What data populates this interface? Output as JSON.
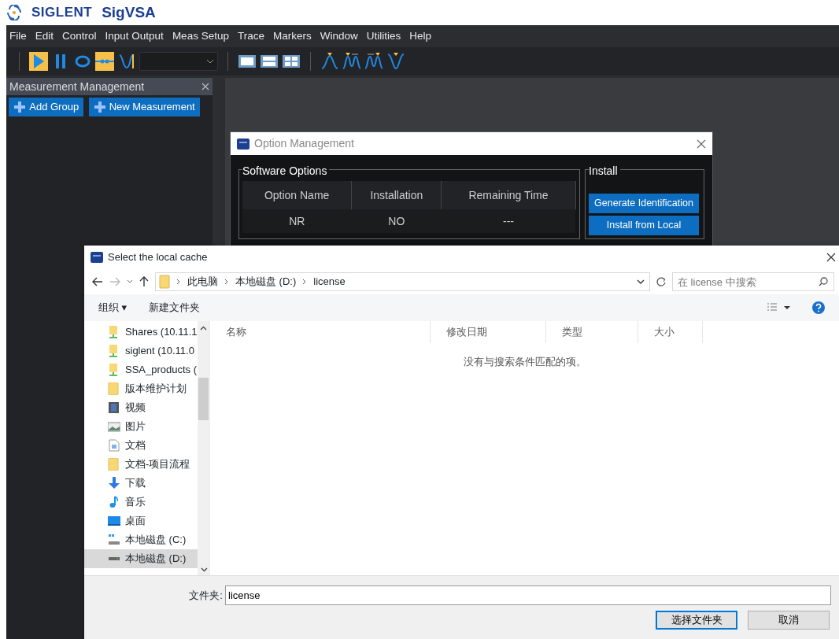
{
  "app": {
    "brand": "SIGLENT",
    "title": "SigVSA"
  },
  "menu": [
    "File",
    "Edit",
    "Control",
    "Input Output",
    "Meas Setup",
    "Trace",
    "Markers",
    "Window",
    "Utilities",
    "Help"
  ],
  "toolbar": [
    {
      "kind": "play",
      "selected": true
    },
    {
      "kind": "pause",
      "selected": false
    },
    {
      "kind": "loop",
      "selected": false
    },
    {
      "kind": "step",
      "selected": true
    },
    {
      "kind": "sweep",
      "selected": false
    },
    {
      "kind": "combo"
    },
    {
      "kind": "layout1",
      "selected": false
    },
    {
      "kind": "layout2",
      "selected": false
    },
    {
      "kind": "layout4",
      "selected": false
    },
    {
      "kind": "peak",
      "selected": false
    },
    {
      "kind": "peakleft",
      "selected": false
    },
    {
      "kind": "peakright",
      "selected": false
    },
    {
      "kind": "min",
      "selected": false
    }
  ],
  "panel": {
    "title": "Measurement Management",
    "buttons": [
      "Add Group",
      "New Measurement"
    ]
  },
  "option_dialog": {
    "title": "Option Management",
    "software_group": "Software Options",
    "columns": [
      "Option Name",
      "Installation",
      "Remaining Time"
    ],
    "rows": [
      [
        "NR",
        "NO",
        "---"
      ]
    ],
    "install_group": "Install",
    "buttons": [
      "Generate Identification",
      "Install from Local"
    ]
  },
  "file_dialog": {
    "title": "Select the local cache",
    "path": [
      "此电脑",
      "本地磁盘 (D:)",
      "license"
    ],
    "search": {
      "placeholder": "在 license 中搜索"
    },
    "commands": [
      "组织 ▾",
      "新建文件夹"
    ],
    "nav": [
      {
        "label": "Shares (10.11.1",
        "kind": "netdrive",
        "selected": false
      },
      {
        "label": "siglent (10.11.0",
        "kind": "netdrive",
        "selected": false
      },
      {
        "label": "SSA_products (",
        "kind": "netdrive",
        "selected": false
      },
      {
        "label": "版本维护计划",
        "kind": "folder",
        "selected": false
      },
      {
        "label": "视频",
        "kind": "video",
        "selected": false
      },
      {
        "label": "图片",
        "kind": "pictures",
        "selected": false
      },
      {
        "label": "文档",
        "kind": "document",
        "selected": false
      },
      {
        "label": "文档-项目流程",
        "kind": "folder",
        "selected": false
      },
      {
        "label": "下载",
        "kind": "download",
        "selected": false
      },
      {
        "label": "音乐",
        "kind": "music",
        "selected": false
      },
      {
        "label": "桌面",
        "kind": "desktop",
        "selected": false
      },
      {
        "label": "本地磁盘 (C:)",
        "kind": "systemdrive",
        "selected": false
      },
      {
        "label": "本地磁盘 (D:)",
        "kind": "drive",
        "selected": true
      }
    ],
    "columns": [
      "名称",
      "修改日期",
      "类型",
      "大小"
    ],
    "empty_message": "没有与搜索条件匹配的项。",
    "folder_label": "文件夹:",
    "folder_value": "license",
    "buttons": [
      "选择文件夹",
      "取消"
    ]
  }
}
